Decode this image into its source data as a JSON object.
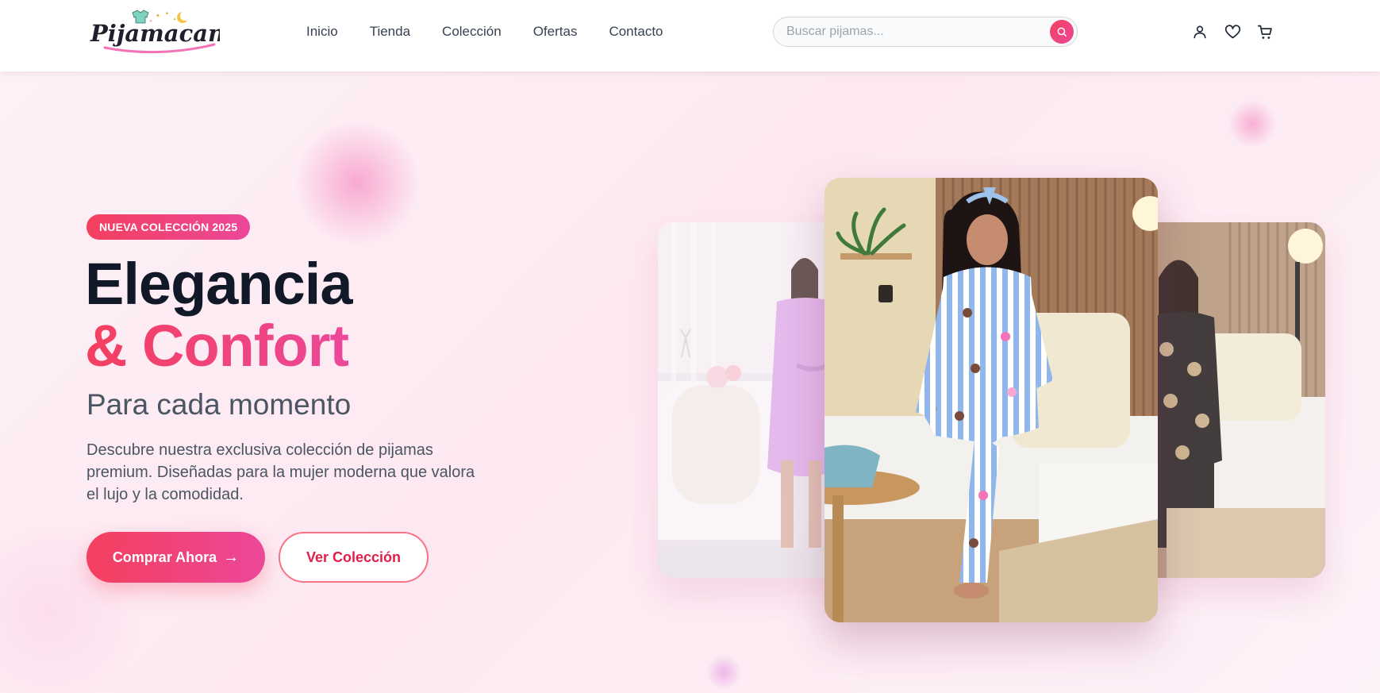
{
  "header": {
    "logo_alt": "Pijamacandy",
    "nav": [
      {
        "label": "Inicio"
      },
      {
        "label": "Tienda"
      },
      {
        "label": "Colección"
      },
      {
        "label": "Ofertas"
      },
      {
        "label": "Contacto"
      }
    ],
    "search": {
      "placeholder": "Buscar pijamas...",
      "value": ""
    },
    "icons": [
      "user-icon",
      "heart-icon",
      "cart-icon",
      "search-icon"
    ]
  },
  "hero": {
    "badge": "NUEVA COLECCIÓN 2025",
    "title_line1": "Elegancia",
    "title_line2": "& Confort",
    "subtitle": "Para cada momento",
    "description": "Descubre nuestra exclusiva colección de pijamas premium. Diseñadas para la mujer moderna que valora el lujo y la comodidad.",
    "primary_cta": "Comprar Ahora",
    "primary_cta_arrow": "→",
    "secondary_cta": "Ver Colección",
    "images": [
      {
        "name": "lilac-robe-model",
        "description_color": "#d9a6e6"
      },
      {
        "name": "blue-striped-pajama-model",
        "description_color": "#9cc3ef"
      },
      {
        "name": "dark-bear-print-pajama-model",
        "description_color": "#3a3230"
      }
    ]
  },
  "colors": {
    "accent_start": "#f43f5e",
    "accent_end": "#ec4899",
    "hero_bg": "#fdeef5",
    "title_dark": "#111827",
    "text_muted": "#4b5563"
  }
}
